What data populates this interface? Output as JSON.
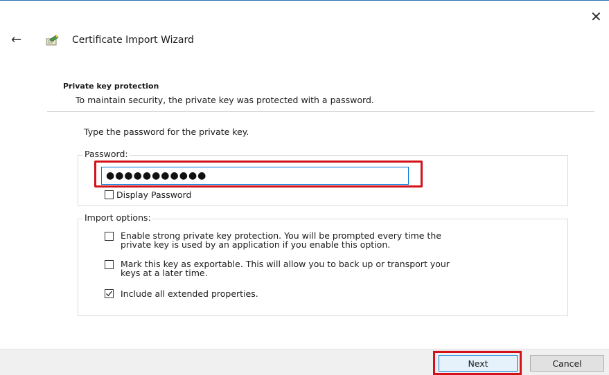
{
  "window": {
    "title": "Certificate Import Wizard",
    "close_glyph": "✕",
    "back_glyph": "←"
  },
  "header": {
    "title": "Private key protection",
    "subtitle": "To maintain security, the private key was protected with a password."
  },
  "instruction": "Type the password for the private key.",
  "password_group": {
    "legend": "Password:",
    "masked_value": "●●●●●●●●●●●",
    "display_password_label": "Display Password",
    "display_password_checked": false
  },
  "import_options": {
    "legend": "Import options:",
    "options": [
      {
        "line1": "Enable strong private key protection. You will be prompted every time the",
        "line2": "private key is used by an application if you enable this option.",
        "checked": false
      },
      {
        "line1": "Mark this key as exportable. This will allow you to back up or transport your",
        "line2": "keys at a later time.",
        "checked": false
      },
      {
        "line1": "Include all extended properties.",
        "line2": "",
        "checked": true
      }
    ]
  },
  "buttons": {
    "next_label": "Next",
    "cancel_label": "Cancel"
  },
  "colors": {
    "highlight_red": "#d3111a",
    "focus_blue": "#0078d7",
    "footer_gray": "#f0f0f0"
  },
  "icons": {
    "wizard": "certificate-wizard-icon",
    "back": "back-arrow-icon",
    "close": "close-icon",
    "check": "checkmark-icon"
  }
}
